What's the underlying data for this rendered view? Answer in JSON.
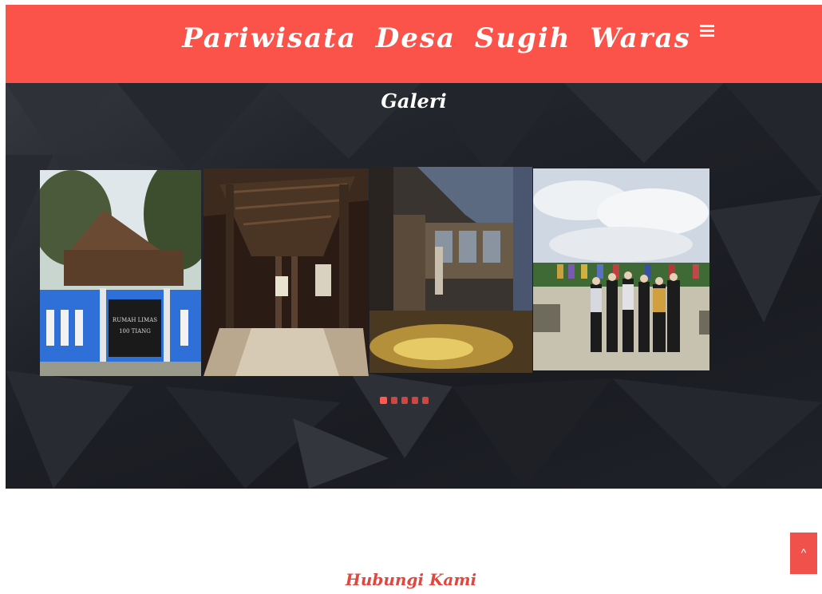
{
  "header": {
    "brand_title": "Pariwisata  Desa Sugih Waras",
    "menu_icon": "hamburger-icon"
  },
  "gallery": {
    "title": "Galeri",
    "slides": [
      {
        "sign_text_line1": "RUMAH LIMAS",
        "sign_text_line2": "100 TIANG"
      },
      {},
      {},
      {}
    ],
    "dots_count": 5,
    "active_dot": 1
  },
  "contact": {
    "title": "Hubungi Kami"
  },
  "scroll_top": {
    "label": "^",
    "icon": "chevron-up-icon"
  },
  "colors": {
    "accent": "#fb5249",
    "gallery_bg": "#1f2128"
  }
}
